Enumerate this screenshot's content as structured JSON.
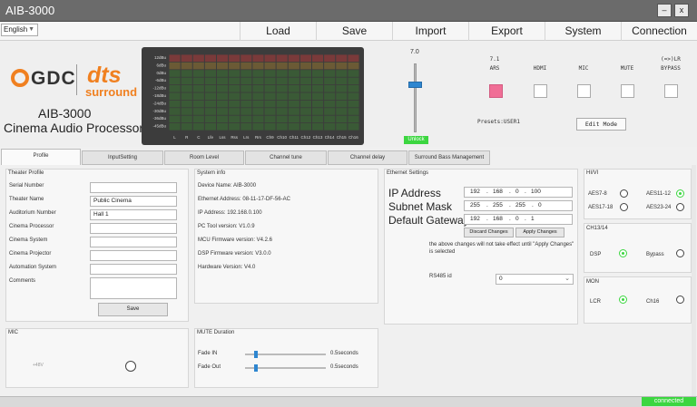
{
  "window": {
    "title": "AIB-3000",
    "minimize": "–",
    "close": "x"
  },
  "menubar": {
    "language": "English",
    "items": [
      "Load",
      "Save",
      "Import",
      "Export",
      "System",
      "Connection"
    ]
  },
  "header": {
    "gdc_logo": "GDC",
    "dts_logo": "dts",
    "dts_sub": "surround",
    "product_line1": "AIB-3000",
    "product_line2": "Cinema Audio Processor",
    "meter_scale": [
      "12dBu",
      "6dBu",
      "0dBu",
      "-6dBu",
      "-12dBu",
      "-18dBu",
      "-24dBu",
      "-30dBu",
      "-36dBu",
      "-45dBu"
    ],
    "meter_channels": [
      "L",
      "R",
      "C",
      "Lfe",
      "Lss",
      "Rss",
      "Lrs",
      "Rrs",
      "Ch9",
      "Ch10",
      "Ch11",
      "Ch12",
      "Ch13",
      "Ch14",
      "Ch15",
      "Ch16"
    ],
    "volume_value": "7.0",
    "unlock_label": "Unlock",
    "inputs": [
      {
        "top": "7.1",
        "label": "ARS",
        "active": true
      },
      {
        "top": "",
        "label": "HDMI",
        "active": false
      },
      {
        "top": "",
        "label": "MIC",
        "active": false
      },
      {
        "top": "",
        "label": "MUTE",
        "active": false
      },
      {
        "top": "(=>)LR",
        "label": "BYPASS",
        "active": false
      }
    ],
    "presets": "Presets:USER1",
    "edit_mode": "Edit Mode",
    "active_color": "#f06e96"
  },
  "tabs": [
    "Profile",
    "InputSetting",
    "Room Level",
    "Channel tune",
    "Channel delay",
    "Surround Bass Management"
  ],
  "theater_profile": {
    "title": "Theater Profile",
    "fields": [
      {
        "label": "Serial Number",
        "value": ""
      },
      {
        "label": "Theater Name",
        "value": "Public Cinema"
      },
      {
        "label": "Auditorium Number",
        "value": "Hall 1"
      },
      {
        "label": "Cinema Processor",
        "value": ""
      },
      {
        "label": "Cinema System",
        "value": ""
      },
      {
        "label": "Cinema Projector",
        "value": ""
      },
      {
        "label": "Automation System",
        "value": ""
      },
      {
        "label": "Comments",
        "value": ""
      }
    ],
    "save": "Save"
  },
  "system_info": {
    "title": "System info",
    "lines": [
      "Device Name:  AIB-3000",
      "Ethernet Address: 08-11-17-DF-56-AC",
      "IP Address: 192.168.0.100",
      "PC Tool version: V1.0.9",
      "MCU Firmware version: V4.2.6",
      "DSP Firmware version: V3.0.0",
      "Hardware Version: V4.0"
    ]
  },
  "ethernet": {
    "title": "Ethernet Settings",
    "rows": [
      {
        "label": "IP Address",
        "octets": [
          "192",
          "168",
          "0",
          "100"
        ]
      },
      {
        "label": "Subnet Mask",
        "octets": [
          "255",
          "255",
          "255",
          "0"
        ]
      },
      {
        "label": "Default Gateway",
        "octets": [
          "192",
          "168",
          "0",
          "1"
        ]
      }
    ],
    "discard": "Discard Changes",
    "apply": "Apply Changes",
    "note": "the above changes will not take effect until  \"Apply Changes\" is selected",
    "rs485_label": "RS485 id",
    "rs485_value": "0"
  },
  "hivi": {
    "title": "HI/VI",
    "options": [
      {
        "label": "AES7-8",
        "on": false
      },
      {
        "label": "AES11-12",
        "on": true
      },
      {
        "label": "AES17-18",
        "on": false
      },
      {
        "label": "AES23-24",
        "on": false
      }
    ]
  },
  "ch1314": {
    "title": "CH13/14",
    "options": [
      {
        "label": "DSP",
        "on": true
      },
      {
        "label": "Bypass",
        "on": false
      }
    ]
  },
  "mon": {
    "title": "MON",
    "options": [
      {
        "label": "LCR",
        "on": true
      },
      {
        "label": "Ch16",
        "on": false
      }
    ]
  },
  "mic": {
    "title": "MIC",
    "phantom": "+48V"
  },
  "mute_duration": {
    "title": "MUTE Duration",
    "fade_in_label": "Fade IN",
    "fade_in_value": "0.5seconds",
    "fade_out_label": "Fade Out",
    "fade_out_value": "0.5seconds"
  },
  "status": {
    "connection": "connected",
    "color": "#3cd640"
  }
}
